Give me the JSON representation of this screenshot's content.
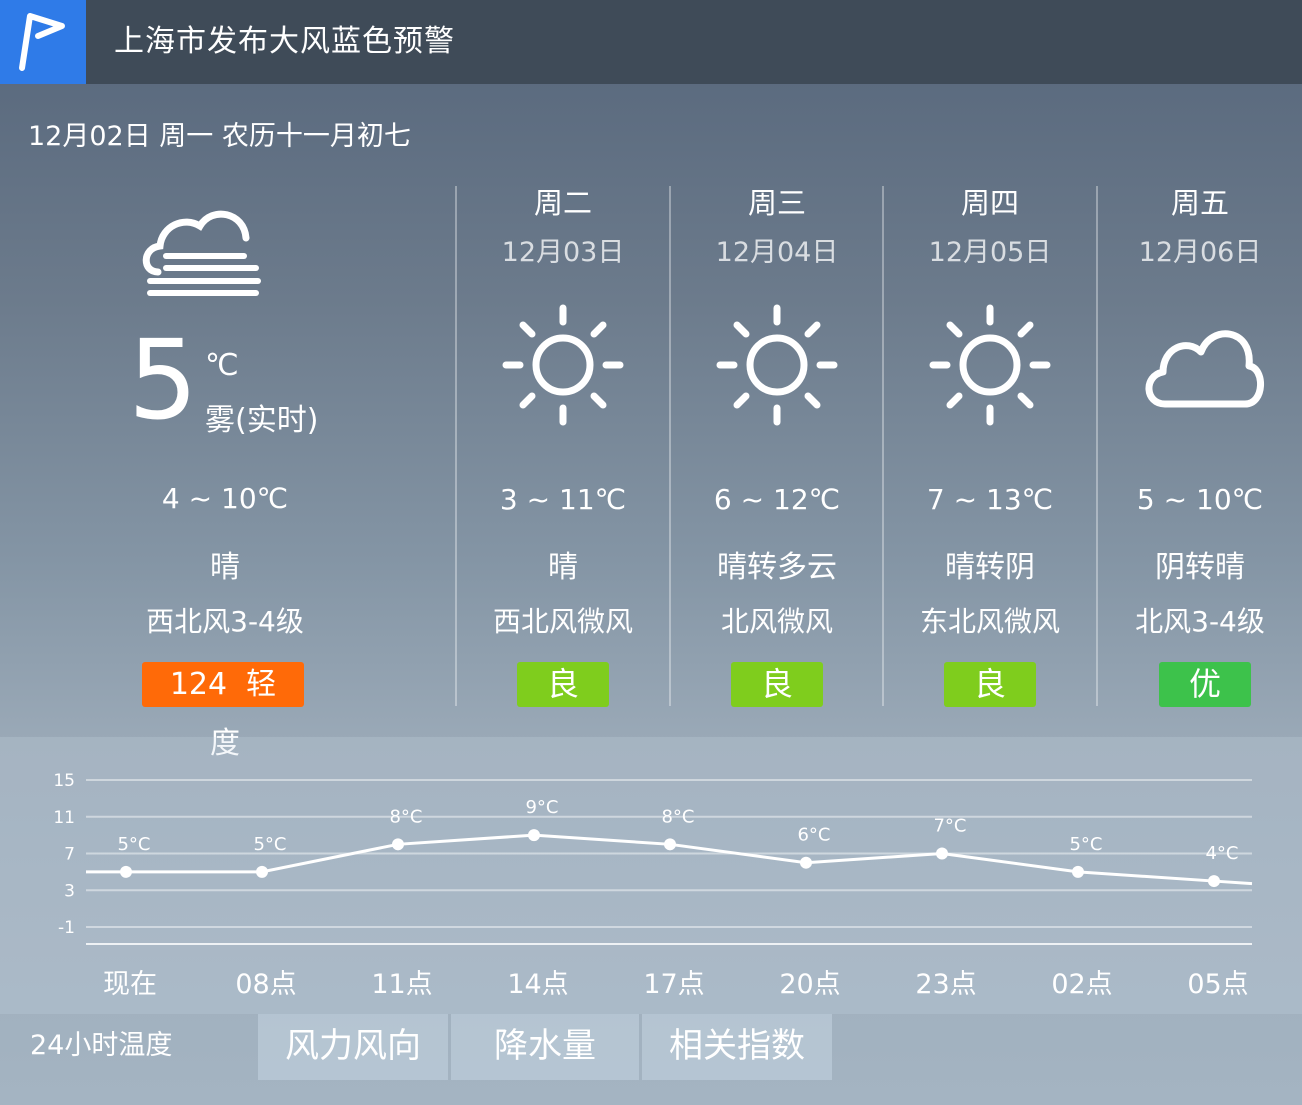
{
  "alert": {
    "text": "上海市发布大风蓝色预警",
    "icon": "flag-icon"
  },
  "date_line": "12月02日 周一 农历十一月初七",
  "today": {
    "icon": "fog-icon",
    "temp": "5",
    "unit": "℃",
    "cond_now": "雾(实时)",
    "range": "4 ~ 10℃",
    "cond": "晴",
    "wind": "西北风3-4级",
    "aqi_value": "124",
    "aqi_level": "轻",
    "aqi_extra": "度",
    "aqi_color": "#ff6a08"
  },
  "forecast": [
    {
      "name": "周二",
      "date": "12月03日",
      "icon": "sun-icon",
      "range": "3 ~ 11℃",
      "cond": "晴",
      "wind": "西北风微风",
      "aqi": "良",
      "aqi_color": "#7fcd1d"
    },
    {
      "name": "周三",
      "date": "12月04日",
      "icon": "sun-icon",
      "range": "6 ~ 12℃",
      "cond": "晴转多云",
      "wind": "北风微风",
      "aqi": "良",
      "aqi_color": "#7fcd1d"
    },
    {
      "name": "周四",
      "date": "12月05日",
      "icon": "sun-icon",
      "range": "7 ~ 13℃",
      "cond": "晴转阴",
      "wind": "东北风微风",
      "aqi": "良",
      "aqi_color": "#7fcd1d"
    },
    {
      "name": "周五",
      "date": "12月06日",
      "icon": "cloud-icon",
      "range": "5 ~ 10℃",
      "cond": "阴转晴",
      "wind": "北风3-4级",
      "aqi": "优",
      "aqi_color": "#3dc24b"
    }
  ],
  "chart_data": {
    "type": "line",
    "ylim": [
      -1,
      15
    ],
    "yticks": [
      "15",
      "11",
      "7",
      "3",
      "-1"
    ],
    "categories": [
      "现在",
      "08点",
      "11点",
      "14点",
      "17点",
      "20点",
      "23点",
      "02点",
      "05点"
    ],
    "values": [
      5,
      5,
      8,
      9,
      8,
      6,
      7,
      5,
      4
    ],
    "point_labels": [
      "5°C",
      "5°C",
      "8°C",
      "9°C",
      "8°C",
      "6°C",
      "7°C",
      "5°C",
      "4°C"
    ],
    "grid": true
  },
  "tabs": [
    "24小时温度",
    "风力风向",
    "降水量",
    "相关指数"
  ]
}
